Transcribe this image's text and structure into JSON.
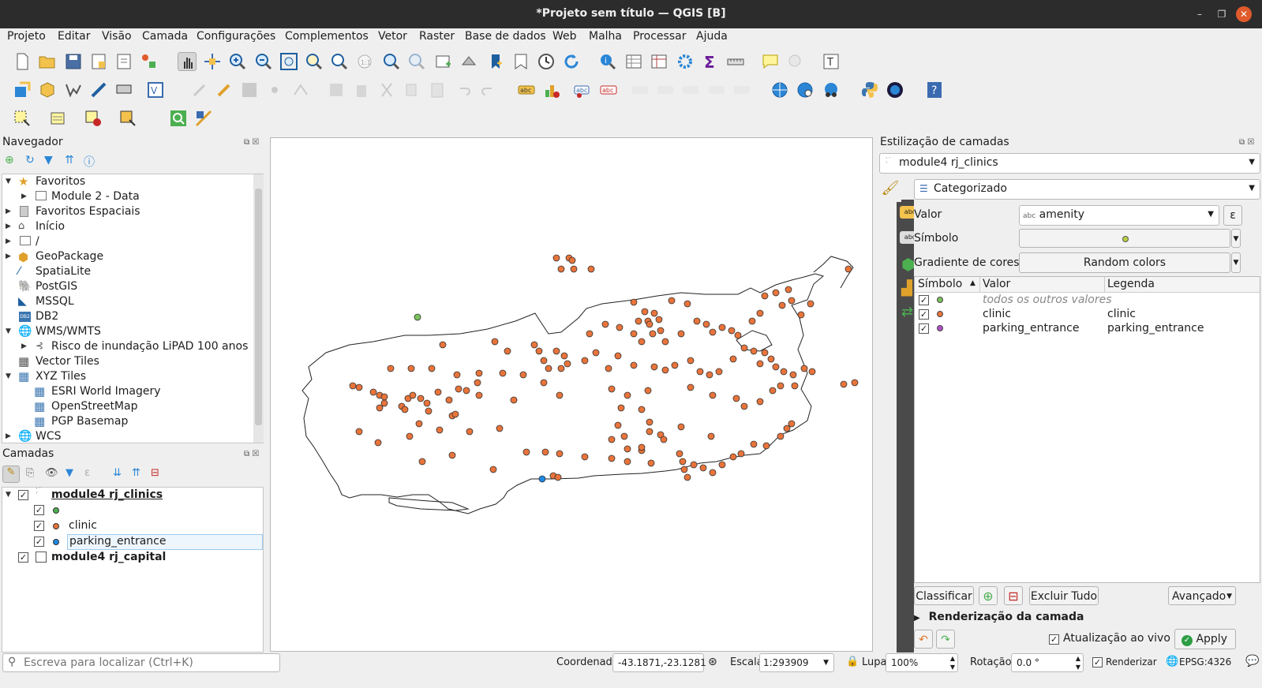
{
  "window": {
    "title": "*Projeto sem título — QGIS [B]"
  },
  "menu": [
    "Projeto",
    "Editar",
    "Visão",
    "Camada",
    "Configurações",
    "Complementos",
    "Vetor",
    "Raster",
    "Base de dados",
    "Web",
    "Malha",
    "Processar",
    "Ajuda"
  ],
  "browser": {
    "title": "Navegador",
    "items": [
      {
        "label": "Favoritos",
        "icon": "star-icon",
        "expanded": true
      },
      {
        "label": "Module 2 - Data",
        "icon": "folder-icon"
      },
      {
        "label": "Favoritos Espaciais",
        "icon": "spatial-bookmark-icon"
      },
      {
        "label": "Início",
        "icon": "home-folder-icon"
      },
      {
        "label": "/",
        "icon": "folder-icon"
      },
      {
        "label": "GeoPackage",
        "icon": "geopackage-icon"
      },
      {
        "label": "SpatiaLite",
        "icon": "spatialite-icon"
      },
      {
        "label": "PostGIS",
        "icon": "postgis-icon"
      },
      {
        "label": "MSSQL",
        "icon": "mssql-icon"
      },
      {
        "label": "DB2",
        "icon": "db2-icon"
      },
      {
        "label": "WMS/WMTS",
        "icon": "globe-icon",
        "expanded": true
      },
      {
        "label": "Risco de inundação LiPAD 100 anos",
        "icon": "wms-layer-icon"
      },
      {
        "label": "Vector Tiles",
        "icon": "grid-icon"
      },
      {
        "label": "XYZ Tiles",
        "icon": "grid-icon",
        "expanded": true
      },
      {
        "label": "ESRI World Imagery",
        "icon": "grid-icon"
      },
      {
        "label": "OpenStreetMap",
        "icon": "grid-icon"
      },
      {
        "label": "PGP Basemap",
        "icon": "grid-icon"
      },
      {
        "label": "WCS",
        "icon": "globe-icon"
      }
    ]
  },
  "layers": {
    "title": "Camadas",
    "items": [
      {
        "label": "module4 rj_clinics",
        "checked": true,
        "bold": true,
        "underline": true
      },
      {
        "label": "",
        "checked": true,
        "color": "#4caf50"
      },
      {
        "label": "clinic",
        "checked": true,
        "color": "#e8743b"
      },
      {
        "label": "parking_entrance",
        "checked": true,
        "color": "#1e88e5"
      },
      {
        "label": "module4 rj_capital",
        "checked": true,
        "bold": true
      }
    ]
  },
  "styling": {
    "title": "Estilização de camadas",
    "layer": "module4 rj_clinics",
    "renderer": "Categorizado",
    "value_label": "Valor",
    "value": "amenity",
    "value_prefix": "abc",
    "symbol_label": "Símbolo",
    "ramp_label": "Gradiente de cores",
    "ramp": "Random colors",
    "columns": [
      "Símbolo",
      "Valor",
      "Legenda"
    ],
    "categories": [
      {
        "value": "todos os outros valores",
        "legend": "",
        "color": "#7cc35e",
        "italic": true
      },
      {
        "value": "clinic",
        "legend": "clinic",
        "color": "#e8743b"
      },
      {
        "value": "parking_entrance",
        "legend": "parking_entrance",
        "color": "#b04fc7"
      }
    ],
    "classify": "Classificar",
    "delete_all": "Excluir Tudo",
    "advanced": "Avançado",
    "render_section": "Renderização da camada",
    "live_update": "Atualização ao vivo",
    "apply": "Apply"
  },
  "status": {
    "search_placeholder": "Escreva para localizar (Ctrl+K)",
    "coord_label": "Coordenada",
    "coord": "-43.1871,-23.1281",
    "scale_label": "Escala",
    "scale": "1:293909",
    "zoom_label": "Lupa",
    "zoom": "100%",
    "rotation_label": "Rotação",
    "rotation": "0.0 °",
    "render_label": "Renderizar",
    "crs": "EPSG:4326"
  },
  "colors": {
    "clinic": "#e8743b",
    "parking": "#1e88e5",
    "other": "#7cc35e"
  }
}
